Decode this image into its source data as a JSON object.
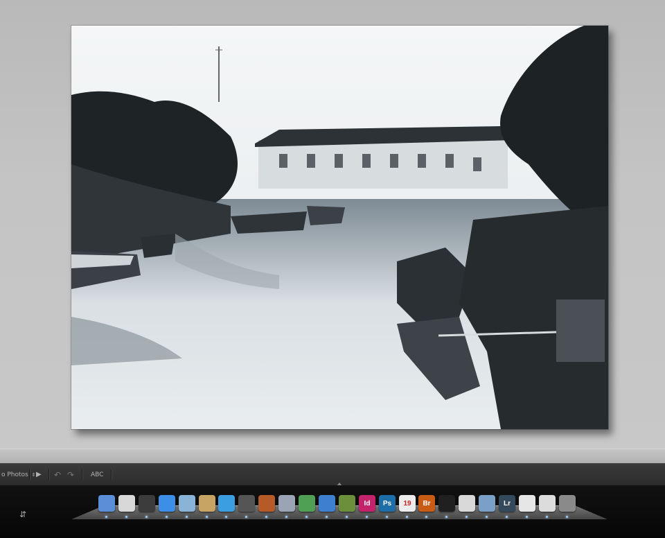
{
  "toolbar": {
    "slideshow_menu": "o Photos",
    "spell_label": "ABC",
    "play_icon": "play-icon",
    "undo_icon": "rotate-left-icon",
    "redo_icon": "rotate-right-icon"
  },
  "dock": {
    "items": [
      {
        "name": "finder-icon",
        "color": "#5a8fd8",
        "glyph": ""
      },
      {
        "name": "launchpad-icon",
        "color": "#d8d8d8",
        "glyph": ""
      },
      {
        "name": "dashboard-icon",
        "color": "#3c3c3c",
        "glyph": ""
      },
      {
        "name": "safari-icon",
        "color": "#3d8ee6",
        "glyph": ""
      },
      {
        "name": "preview-icon",
        "color": "#8ab3d8",
        "glyph": ""
      },
      {
        "name": "notes-icon",
        "color": "#c8a464",
        "glyph": ""
      },
      {
        "name": "itunes-icon",
        "color": "#3a9ee0",
        "glyph": ""
      },
      {
        "name": "photo-booth-icon",
        "color": "#555555",
        "glyph": ""
      },
      {
        "name": "keynote-icon",
        "color": "#b65a28",
        "glyph": ""
      },
      {
        "name": "script-editor-icon",
        "color": "#9aa4b4",
        "glyph": ""
      },
      {
        "name": "numbers-icon",
        "color": "#4f9f54",
        "glyph": ""
      },
      {
        "name": "network-icon",
        "color": "#3f7fcf",
        "glyph": ""
      },
      {
        "name": "minecraft-icon",
        "color": "#6b8f3a",
        "glyph": ""
      },
      {
        "name": "indesign-icon",
        "color": "#c2236b",
        "glyph": "Id"
      },
      {
        "name": "photoshop-icon",
        "color": "#1d6ea8",
        "glyph": "Ps"
      },
      {
        "name": "calendar-icon",
        "color": "#ececec",
        "glyph": "19"
      },
      {
        "name": "bridge-icon",
        "color": "#c95b14",
        "glyph": "Br"
      },
      {
        "name": "activity-monitor-icon",
        "color": "#202020",
        "glyph": ""
      },
      {
        "name": "pages-icon",
        "color": "#d9d9d9",
        "glyph": ""
      },
      {
        "name": "iphoto-icon",
        "color": "#7aa0c8",
        "glyph": ""
      },
      {
        "name": "lightroom-icon",
        "color": "#34495c",
        "glyph": "Lr"
      },
      {
        "name": "documents-stack-icon",
        "color": "#e6e6e6",
        "glyph": ""
      },
      {
        "name": "downloads-stack-icon",
        "color": "#dcdcdc",
        "glyph": ""
      },
      {
        "name": "trash-icon",
        "color": "#8a8a8a",
        "glyph": ""
      }
    ]
  }
}
